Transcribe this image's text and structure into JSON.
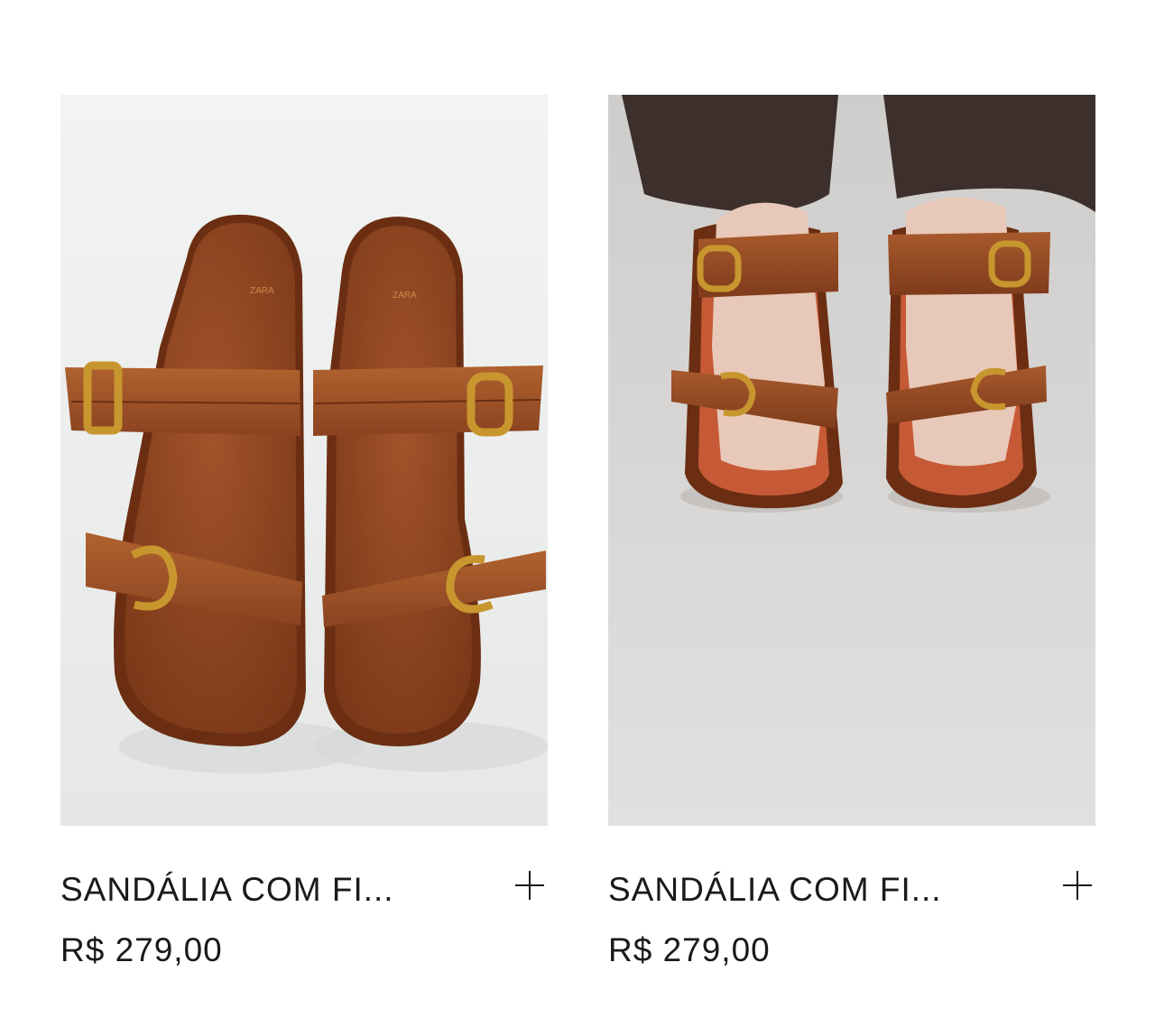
{
  "products": [
    {
      "image_label": "Sandal product photo",
      "name": "SANDÁLIA COM FI...",
      "price": "R$ 279,00",
      "add_icon": "plus-icon"
    },
    {
      "image_label": "Sandal worn on model",
      "name": "SANDÁLIA COM FI...",
      "price": "R$ 279,00",
      "add_icon": "plus-icon"
    }
  ],
  "colors": {
    "leather": "#8a4220",
    "leather_light": "#a85a2c",
    "buckle": "#c8962e",
    "photo_bg_left": "#eef0ef",
    "photo_bg_right": "#dcdad8"
  }
}
